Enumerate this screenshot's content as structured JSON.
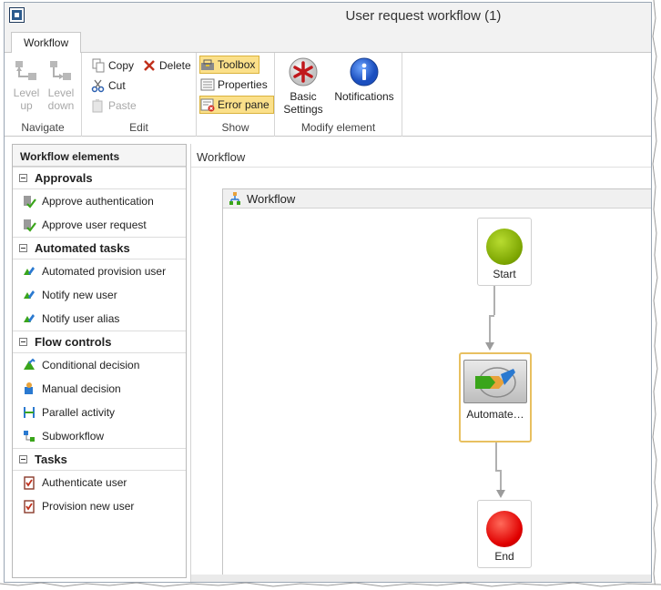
{
  "window": {
    "title": "User request workflow (1)"
  },
  "ribbon": {
    "tab": "Workflow",
    "navigate": {
      "label": "Navigate",
      "level_up": "Level up",
      "level_down": "Level down"
    },
    "edit": {
      "label": "Edit",
      "copy": "Copy",
      "delete": "Delete",
      "cut": "Cut",
      "paste": "Paste"
    },
    "show": {
      "label": "Show",
      "toolbox": "Toolbox",
      "properties": "Properties",
      "error_pane": "Error pane"
    },
    "modify": {
      "label": "Modify element",
      "basic_settings": "Basic Settings",
      "notifications": "Notifications"
    }
  },
  "left_pane": {
    "header": "Workflow elements",
    "sections": [
      {
        "label": "Approvals",
        "items": [
          "Approve authentication",
          "Approve user request"
        ]
      },
      {
        "label": "Automated tasks",
        "items": [
          "Automated provision user",
          "Notify new user",
          "Notify user alias"
        ]
      },
      {
        "label": "Flow controls",
        "items": [
          "Conditional decision",
          "Manual decision",
          "Parallel activity",
          "Subworkflow"
        ]
      },
      {
        "label": "Tasks",
        "items": [
          "Authenticate user",
          "Provision new user"
        ]
      }
    ]
  },
  "canvas": {
    "header": "Workflow",
    "frame_title": "Workflow",
    "nodes": {
      "start": "Start",
      "automated": "Automate…",
      "end": "End"
    }
  },
  "colors": {
    "start": "#8db600",
    "end": "#e00000",
    "toolbar_active": "#fbe08a",
    "selection": "#e8c060"
  }
}
